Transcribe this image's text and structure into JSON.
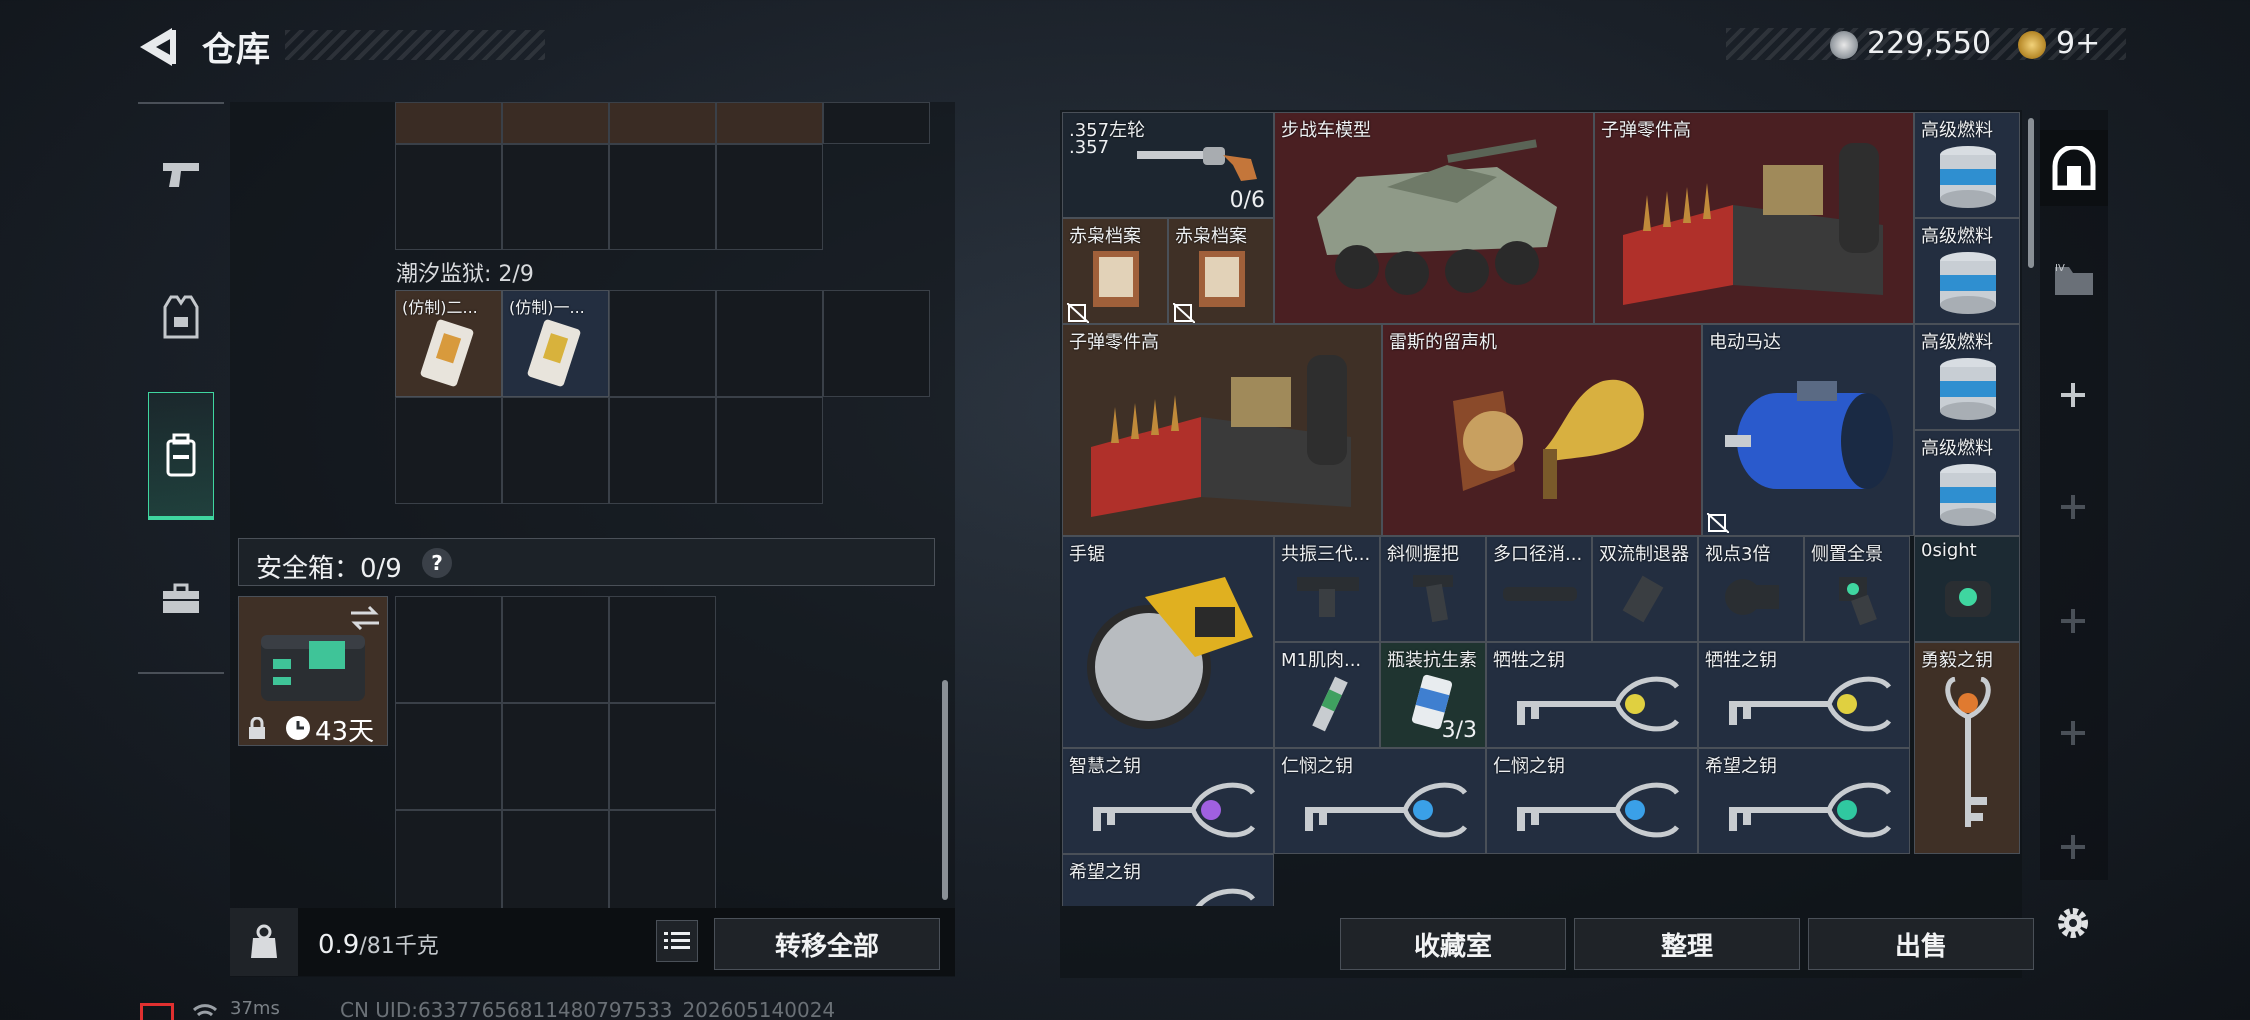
{
  "header": {
    "title": "仓库",
    "currency_amount": "229,550",
    "secondary_count": "9+"
  },
  "left_panel": {
    "section_tide_prison": "潮汐监狱: 2/9",
    "tide_items": [
      {
        "label": "(仿制)二..."
      },
      {
        "label": "(仿制)一..."
      }
    ],
    "safe_box": {
      "label": "安全箱：0/9",
      "help": "?",
      "duration": "43天"
    },
    "weight_current": "0.9",
    "weight_max": "/81千克",
    "transfer_all": "转移全部"
  },
  "warehouse": {
    "items": [
      {
        "id": "revolver",
        "label": ".357左轮",
        "sub": ".357",
        "count": "0/6"
      },
      {
        "id": "ifv",
        "label": "步战车模型"
      },
      {
        "id": "ammo1",
        "label": "子弹零件高"
      },
      {
        "id": "fuel1",
        "label": "高级燃料"
      },
      {
        "id": "owl1",
        "label": "赤枭档案"
      },
      {
        "id": "owl2",
        "label": "赤枭档案"
      },
      {
        "id": "fuel2",
        "label": "高级燃料"
      },
      {
        "id": "ammo2",
        "label": "子弹零件高"
      },
      {
        "id": "phono",
        "label": "雷斯的留声机"
      },
      {
        "id": "motor",
        "label": "电动马达"
      },
      {
        "id": "fuel3",
        "label": "高级燃料"
      },
      {
        "id": "fuel4",
        "label": "高级燃料"
      },
      {
        "id": "saw",
        "label": "手锯"
      },
      {
        "id": "res",
        "label": "共振三代..."
      },
      {
        "id": "grip",
        "label": "斜侧握把"
      },
      {
        "id": "supp",
        "label": "多口径消..."
      },
      {
        "id": "brake",
        "label": "双流制退器"
      },
      {
        "id": "scope3",
        "label": "视点3倍"
      },
      {
        "id": "sideholo",
        "label": "侧置全景"
      },
      {
        "id": "osight",
        "label": "0sight"
      },
      {
        "id": "m1",
        "label": "M1肌肉..."
      },
      {
        "id": "antibio",
        "label": "瓶装抗生素",
        "count": "3/3"
      },
      {
        "id": "sac1",
        "label": "牺牲之钥"
      },
      {
        "id": "sac2",
        "label": "牺牲之钥"
      },
      {
        "id": "brave",
        "label": "勇毅之钥"
      },
      {
        "id": "wisdom",
        "label": "智慧之钥"
      },
      {
        "id": "mercy1",
        "label": "仁悯之钥"
      },
      {
        "id": "mercy2",
        "label": "仁悯之钥"
      },
      {
        "id": "hope1",
        "label": "希望之钥"
      },
      {
        "id": "hope2",
        "label": "希望之钥"
      }
    ]
  },
  "bottom_buttons": {
    "collection": "收藏室",
    "organize": "整理",
    "sell": "出售"
  },
  "status": {
    "ping": "37ms",
    "uid": "CN UID:63377656811480797533_202605140024"
  },
  "colors": {
    "accent_green": "#3fd6a0",
    "item_red": "#4a1f22",
    "item_blue": "#232e40",
    "item_brown": "#3f3026"
  }
}
